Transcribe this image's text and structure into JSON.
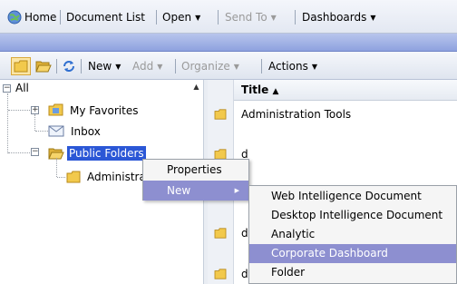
{
  "topbar": {
    "home": "Home",
    "document_list": "Document List",
    "open": "Open",
    "send_to": "Send To",
    "dashboards": "Dashboards"
  },
  "toolbar": {
    "new": "New",
    "add": "Add",
    "organize": "Organize",
    "actions": "Actions"
  },
  "tree": {
    "root": "All",
    "my_favorites": "My Favorites",
    "inbox": "Inbox",
    "public_folders": "Public Folders",
    "administration": "Administra"
  },
  "list": {
    "title_header": "Title",
    "rows": [
      "Administration Tools",
      "d",
      "d",
      "d"
    ]
  },
  "context_menu": {
    "properties": "Properties",
    "new": "New"
  },
  "new_submenu": {
    "items": [
      "Web Intelligence Document",
      "Desktop Intelligence Document",
      "Analytic",
      "Corporate Dashboard",
      "Folder"
    ],
    "highlighted": "Corporate Dashboard"
  },
  "colors": {
    "band": "#9aaee3",
    "selection": "#2b57d6",
    "menu_highlight": "#8d8fd0",
    "folder": "#f2c94c"
  }
}
